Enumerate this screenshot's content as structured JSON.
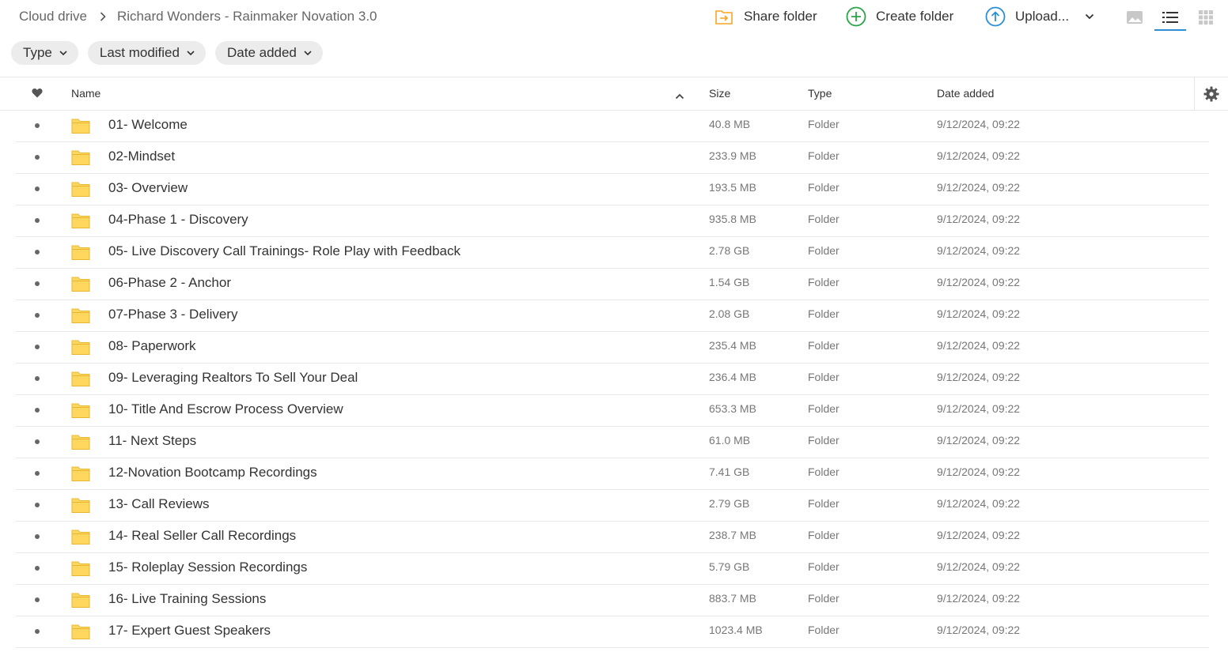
{
  "breadcrumb": {
    "root": "Cloud drive",
    "current": "Richard Wonders - Rainmaker Novation 3.0"
  },
  "actions": {
    "share": "Share folder",
    "create": "Create folder",
    "upload": "Upload..."
  },
  "filters": [
    "Type",
    "Last modified",
    "Date added"
  ],
  "columns": {
    "name": "Name",
    "size": "Size",
    "type": "Type",
    "date": "Date added"
  },
  "colors": {
    "folder": "#ffd75e",
    "folder_outline": "#e8b633",
    "create_green": "#2ba44a",
    "upload_blue": "#2a8fd6",
    "share_orange": "#f5a623"
  },
  "rows": [
    {
      "name": "01- Welcome",
      "size": "40.8 MB",
      "type": "Folder",
      "date": "9/12/2024, 09:22"
    },
    {
      "name": "02-Mindset",
      "size": "233.9 MB",
      "type": "Folder",
      "date": "9/12/2024, 09:22"
    },
    {
      "name": "03- Overview",
      "size": "193.5 MB",
      "type": "Folder",
      "date": "9/12/2024, 09:22"
    },
    {
      "name": "04-Phase 1 - Discovery",
      "size": "935.8 MB",
      "type": "Folder",
      "date": "9/12/2024, 09:22"
    },
    {
      "name": "05- Live Discovery Call Trainings- Role Play with Feedback",
      "size": "2.78 GB",
      "type": "Folder",
      "date": "9/12/2024, 09:22"
    },
    {
      "name": "06-Phase 2 - Anchor",
      "size": "1.54 GB",
      "type": "Folder",
      "date": "9/12/2024, 09:22"
    },
    {
      "name": "07-Phase 3 - Delivery",
      "size": "2.08 GB",
      "type": "Folder",
      "date": "9/12/2024, 09:22"
    },
    {
      "name": "08- Paperwork",
      "size": "235.4 MB",
      "type": "Folder",
      "date": "9/12/2024, 09:22"
    },
    {
      "name": "09- Leveraging Realtors To Sell Your Deal",
      "size": "236.4 MB",
      "type": "Folder",
      "date": "9/12/2024, 09:22"
    },
    {
      "name": "10- Title And Escrow Process Overview",
      "size": "653.3 MB",
      "type": "Folder",
      "date": "9/12/2024, 09:22"
    },
    {
      "name": "11- Next Steps",
      "size": "61.0 MB",
      "type": "Folder",
      "date": "9/12/2024, 09:22"
    },
    {
      "name": "12-Novation Bootcamp Recordings",
      "size": "7.41 GB",
      "type": "Folder",
      "date": "9/12/2024, 09:22"
    },
    {
      "name": "13- Call Reviews",
      "size": "2.79 GB",
      "type": "Folder",
      "date": "9/12/2024, 09:22"
    },
    {
      "name": "14- Real Seller Call Recordings",
      "size": "238.7 MB",
      "type": "Folder",
      "date": "9/12/2024, 09:22"
    },
    {
      "name": "15- Roleplay Session Recordings",
      "size": "5.79 GB",
      "type": "Folder",
      "date": "9/12/2024, 09:22"
    },
    {
      "name": "16- Live Training Sessions",
      "size": "883.7 MB",
      "type": "Folder",
      "date": "9/12/2024, 09:22"
    },
    {
      "name": "17- Expert Guest Speakers",
      "size": "1023.4 MB",
      "type": "Folder",
      "date": "9/12/2024, 09:22"
    }
  ]
}
